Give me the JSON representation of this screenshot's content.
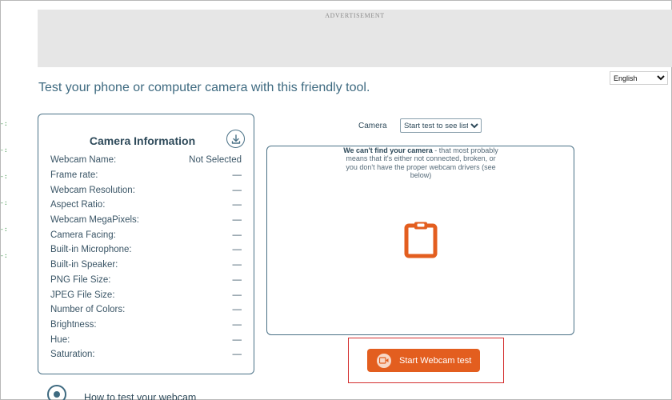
{
  "advertisement": {
    "label": "ADVERTISEMENT"
  },
  "language": {
    "selected": "English",
    "options": [
      "English"
    ]
  },
  "page": {
    "title": "Test your phone or computer camera with this friendly tool."
  },
  "camera_info": {
    "title": "Camera Information",
    "download_icon": "download-icon",
    "rows": [
      {
        "label": "Webcam Name:",
        "value": "Not Selected"
      },
      {
        "label": "Frame rate:",
        "value": "—"
      },
      {
        "label": "Webcam Resolution:",
        "value": "—"
      },
      {
        "label": "Aspect Ratio:",
        "value": "—"
      },
      {
        "label": "Webcam MegaPixels:",
        "value": "—"
      },
      {
        "label": "Camera Facing:",
        "value": "—"
      },
      {
        "label": "Built-in Microphone:",
        "value": "—"
      },
      {
        "label": "Built-in Speaker:",
        "value": "—"
      },
      {
        "label": "PNG File Size:",
        "value": "—"
      },
      {
        "label": "JPEG File Size:",
        "value": "—"
      },
      {
        "label": "Number of Colors:",
        "value": "—"
      },
      {
        "label": "Brightness:",
        "value": "—"
      },
      {
        "label": "Hue:",
        "value": "—"
      },
      {
        "label": "Saturation:",
        "value": "—"
      }
    ]
  },
  "camera_select": {
    "label": "Camera",
    "selected": "Start test to see list"
  },
  "preview": {
    "message_bold": "We can't find your camera",
    "message_rest": " - that most probably means that it's either not connected, broken, or you don't have the proper webcam drivers (see below)",
    "icon": "clipboard-icon"
  },
  "start_button": {
    "label": "Start Webcam test",
    "icon": "webcam-icon"
  },
  "howto": {
    "title": "How to test your webcam",
    "icon": "target-icon"
  },
  "colors": {
    "accent": "#e35e1f",
    "border": "#4a7186",
    "title": "#3e6a80",
    "highlight": "#d32f2f"
  }
}
